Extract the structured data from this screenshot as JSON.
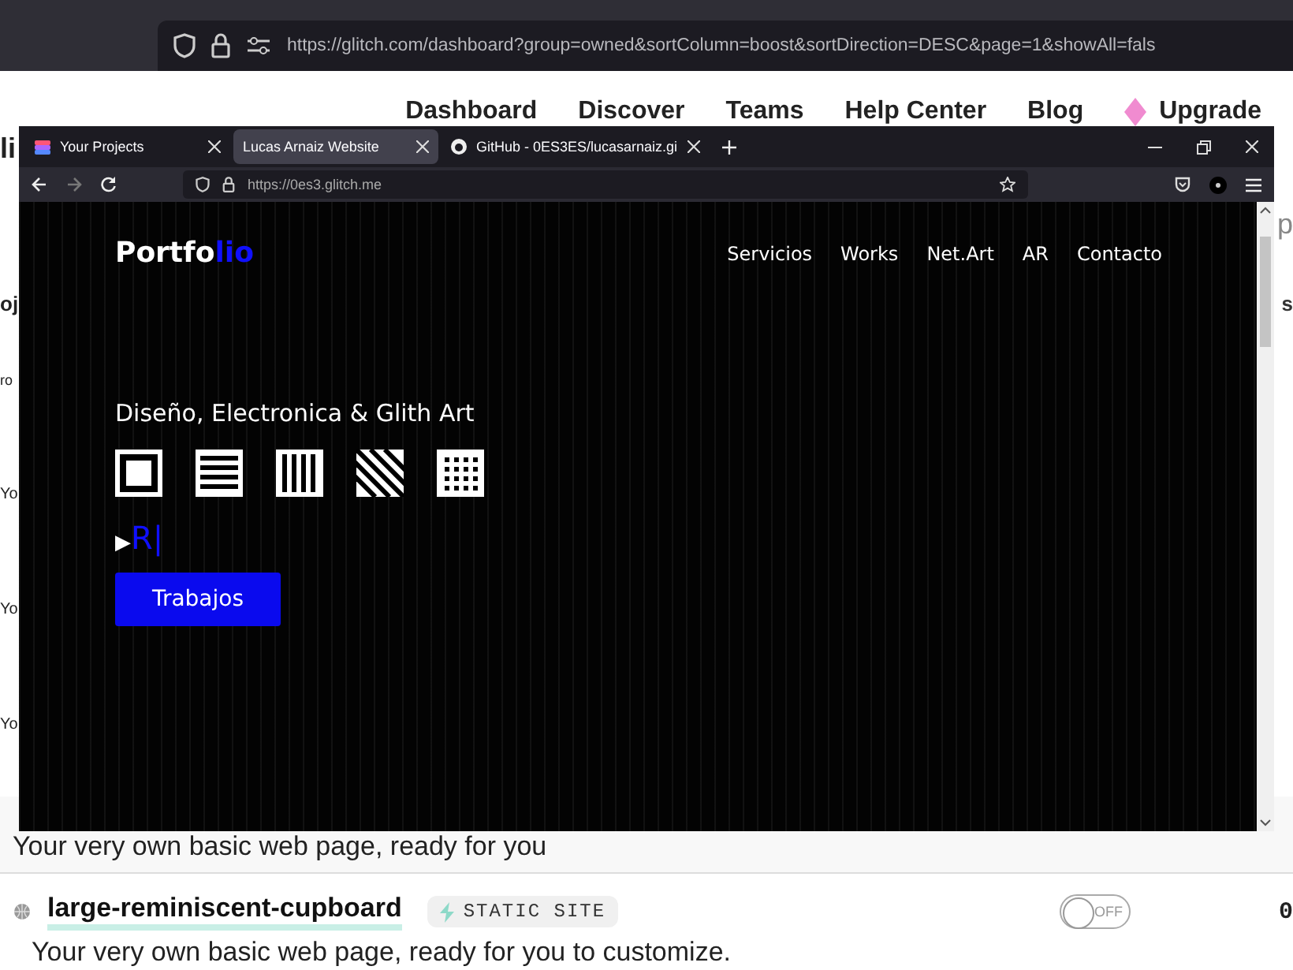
{
  "background_browser": {
    "address": "https://glitch.com/dashboard?group=owned&sortColumn=boost&sortDirection=DESC&page=1&showAll=fals"
  },
  "glitch_nav": {
    "links": [
      "Dashboard",
      "Discover",
      "Teams",
      "Help Center",
      "Blog"
    ],
    "upgrade": "Upgrade"
  },
  "side_fragments": [
    {
      "text": "li",
      "kind": "logo"
    },
    {
      "text": "oj",
      "kind": "heading"
    },
    {
      "text": "ro",
      "kind": "small"
    },
    {
      "text": "Yo",
      "kind": "row"
    },
    {
      "text": "Yo",
      "kind": "row"
    },
    {
      "text": "Yo",
      "kind": "row"
    }
  ],
  "right_fragments": [
    {
      "text": "p",
      "kind": "field"
    },
    {
      "text": "s",
      "kind": "header"
    }
  ],
  "projects": [
    {
      "description": "Your very own basic web page, ready for you"
    },
    {
      "name": "large-reminiscent-cupboard",
      "badge": "STATIC SITE",
      "toggle": {
        "label": "OFF",
        "on": false
      },
      "count": "0",
      "description": "Your very own basic web page, ready for you to customize."
    }
  ],
  "browser_window": {
    "tabs": [
      {
        "label": "Your Projects",
        "selected": false
      },
      {
        "label": "Lucas Arnaiz Website",
        "selected": true
      },
      {
        "label": "GitHub - 0ES3ES/lucasarnaiz.gi",
        "selected": false
      }
    ],
    "address": "https://0es3.glitch.me",
    "site": {
      "logo": {
        "text": "Portfo",
        "accent": "lio"
      },
      "nav": [
        "Servicios",
        "Works",
        "Net.Art",
        "AR",
        "Contacto"
      ],
      "tagline": "Diseño, Electronica & Glith Art",
      "typing": {
        "prompt": "▶",
        "text": "R|"
      },
      "button": "Trabajos"
    }
  }
}
